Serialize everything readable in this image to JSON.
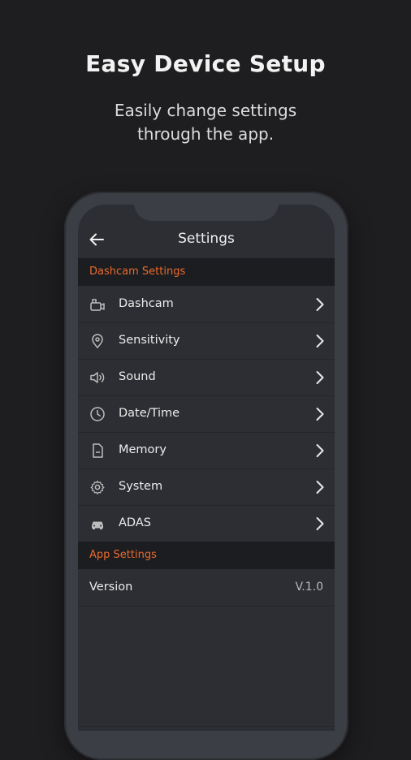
{
  "hero": {
    "title": "Easy Device Setup",
    "subtitle_line1": "Easily change settings",
    "subtitle_line2": "through the app."
  },
  "appbar": {
    "title": "Settings",
    "back_icon": "arrow-left-icon"
  },
  "sections": {
    "dashcam": "Dashcam Settings",
    "app": "App Settings"
  },
  "items": [
    {
      "label": "Dashcam",
      "icon": "dashcam-icon"
    },
    {
      "label": "Sensitivity",
      "icon": "location-pin-icon"
    },
    {
      "label": "Sound",
      "icon": "speaker-icon"
    },
    {
      "label": "Date/Time",
      "icon": "clock-icon"
    },
    {
      "label": "Memory",
      "icon": "sd-card-icon"
    },
    {
      "label": "System",
      "icon": "gear-icon"
    },
    {
      "label": "ADAS",
      "icon": "car-icon"
    }
  ],
  "version": {
    "label": "Version",
    "value": "V.1.0"
  },
  "colors": {
    "background": "#1e1e20",
    "accent": "#e96a2e",
    "screen": "#2c2e33"
  }
}
